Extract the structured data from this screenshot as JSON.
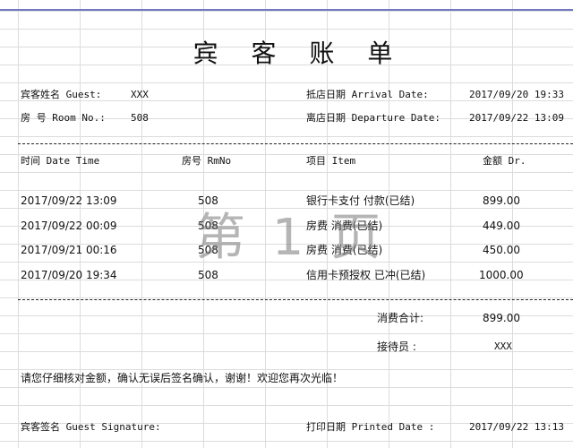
{
  "title": "宾 客 账 单",
  "header": {
    "guest_label": "宾客姓名 Guest:",
    "guest_value": "XXX",
    "room_label": "房 号 Room No.:",
    "room_value": "508",
    "arrival_label": "抵店日期  Arrival Date:",
    "arrival_value": "2017/09/20 19:33",
    "departure_label": "离店日期 Departure Date:",
    "departure_value": "2017/09/22 13:09"
  },
  "columns": {
    "time": "时间 Date Time",
    "room": "房号 RmNo",
    "item": "项目 Item",
    "amount": "金额 Dr."
  },
  "rows": [
    {
      "time": "2017/09/22 13:09",
      "room": "508",
      "item": "银行卡支付 付款(已结)",
      "amount": "899.00"
    },
    {
      "time": "2017/09/22 00:09",
      "room": "508",
      "item": "房费 消费(已结)",
      "amount": "449.00"
    },
    {
      "time": "2017/09/21 00:16",
      "room": "508",
      "item": "房费 消费(已结)",
      "amount": "450.00"
    },
    {
      "time": "2017/09/20 19:34",
      "room": "508",
      "item": "信用卡预授权 已冲(已结)",
      "amount": "1000.00"
    }
  ],
  "watermark": "第 1 页",
  "summary": {
    "total_label": "消费合计:",
    "total_value": "899.00",
    "clerk_label": "接待员 :",
    "clerk_value": "XXX"
  },
  "notice": "请您仔细核对金额，确认无误后签名确认，谢谢！欢迎您再次光临！",
  "footer": {
    "signature_label": "宾客签名 Guest Signature:",
    "printed_label": "打印日期 Printed Date :",
    "printed_value": "2017/09/22 13:13"
  }
}
